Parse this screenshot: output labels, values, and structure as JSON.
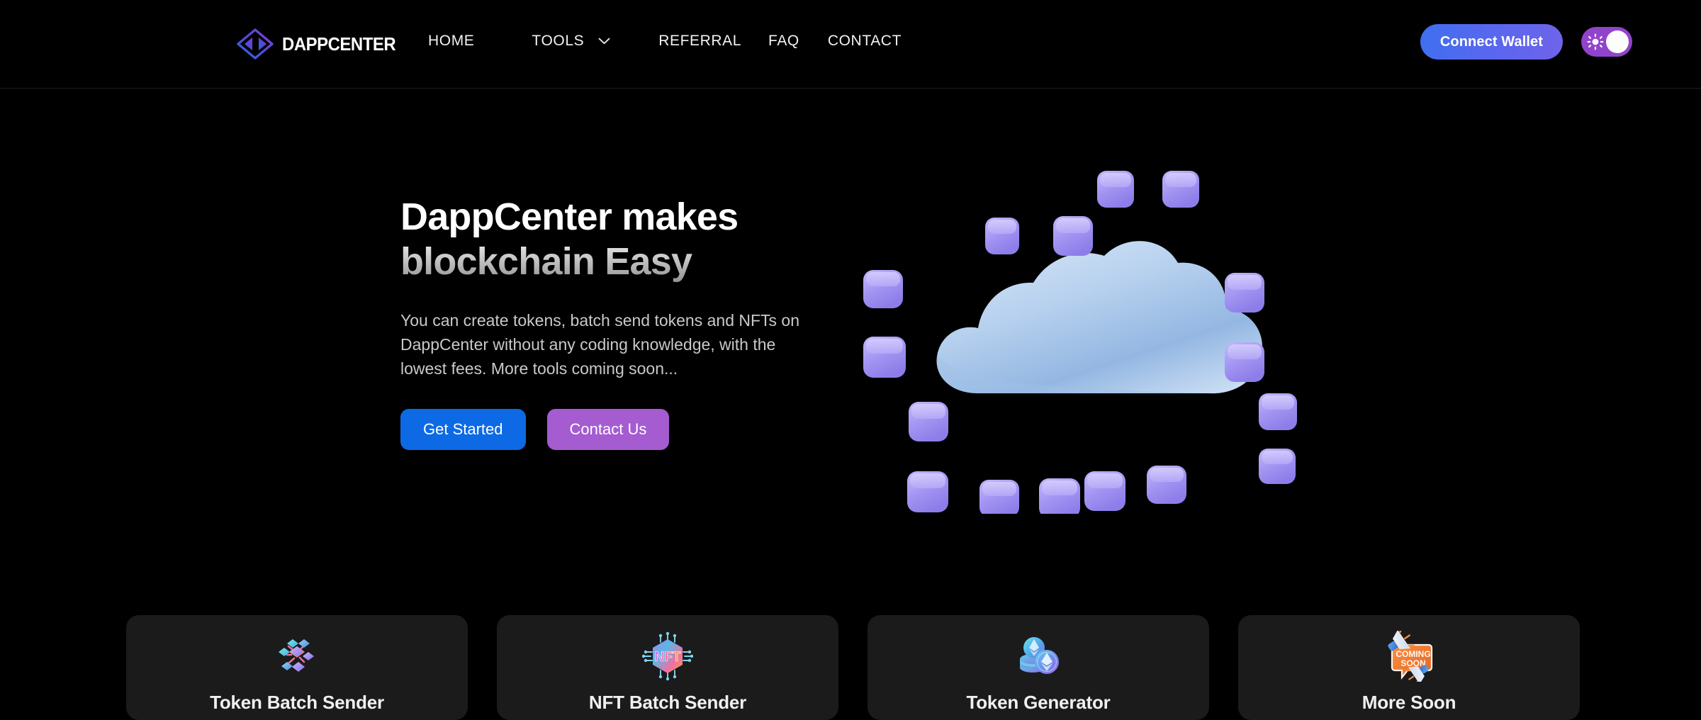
{
  "brand": {
    "name": "DAPPCENTER",
    "logo_icon": "dappcenter-diamond-logo",
    "colors": {
      "logo_start": "#1f6fe0",
      "logo_end": "#7b3fd4"
    }
  },
  "nav": {
    "home": "HOME",
    "tools": "TOOLS",
    "tools_caret_icon": "chevron-down-icon",
    "referral": "REFERRAL",
    "faq": "FAQ",
    "contact": "CONTACT"
  },
  "header_actions": {
    "connect_wallet": "Connect Wallet",
    "theme_toggle_icon": "sun-icon",
    "theme_toggle_state": "on",
    "colors": {
      "connect_start": "#3f6ff0",
      "connect_end": "#6f63ea",
      "toggle_track": "#9243cb",
      "toggle_knob": "#fdfdfd"
    }
  },
  "hero": {
    "title_line1": "DappCenter makes",
    "title_line2": "blockchain Easy",
    "subtitle": "You can create tokens, batch send tokens and NFTs on DappCenter without any coding knowledge, with the lowest fees. More tools coming soon...",
    "cta_primary": "Get Started",
    "cta_secondary": "Contact Us",
    "illustration_icon": "cloud-network-3d-illustration",
    "colors": {
      "primary_btn": "#0d6ae4",
      "secondary_btn": "#a55cd1",
      "cloud": "#a9c8ea",
      "node": "#a99cf0"
    }
  },
  "cards": [
    {
      "title": "Token Batch Sender",
      "icon": "cube-cluster-3d-icon"
    },
    {
      "title": "NFT Batch Sender",
      "icon": "nft-chip-hex-icon"
    },
    {
      "title": "Token Generator",
      "icon": "ethereum-coins-3d-icon"
    },
    {
      "title": "More Soon",
      "icon": "coming-soon-megaphone-icon",
      "badge": "COMING SOON"
    }
  ]
}
